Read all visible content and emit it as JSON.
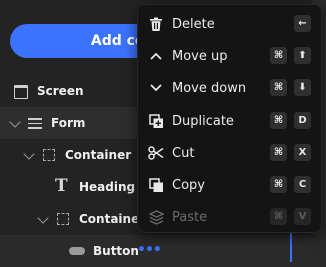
{
  "panel": {
    "add_button_label": "Add comp"
  },
  "tree": {
    "items": [
      {
        "label": "Screen",
        "icon": "screen-icon"
      },
      {
        "label": "Form",
        "icon": "form-icon"
      },
      {
        "label": "Container",
        "icon": "container-icon"
      },
      {
        "label": "Heading",
        "icon": "heading-icon"
      },
      {
        "label": "Container",
        "icon": "container-icon"
      },
      {
        "label": "Button",
        "icon": "button-icon"
      }
    ],
    "more_dots": "•••"
  },
  "menu": {
    "items": [
      {
        "label": "Delete",
        "icon": "trash-icon",
        "keys": [
          "←"
        ]
      },
      {
        "label": "Move up",
        "icon": "chevron-up-icon",
        "keys": [
          "⌘",
          "⬆"
        ]
      },
      {
        "label": "Move down",
        "icon": "chevron-down-icon",
        "keys": [
          "⌘",
          "⬇"
        ]
      },
      {
        "label": "Duplicate",
        "icon": "duplicate-icon",
        "keys": [
          "⌘",
          "D"
        ]
      },
      {
        "label": "Cut",
        "icon": "scissors-icon",
        "keys": [
          "⌘",
          "X"
        ]
      },
      {
        "label": "Copy",
        "icon": "copy-icon",
        "keys": [
          "⌘",
          "C"
        ]
      },
      {
        "label": "Paste",
        "icon": "paste-icon",
        "keys": [
          "⌘",
          "V"
        ],
        "disabled": true
      }
    ]
  },
  "colors": {
    "accent": "#3b73ff",
    "menu_bg": "#141414",
    "panel_bg": "#232323"
  }
}
